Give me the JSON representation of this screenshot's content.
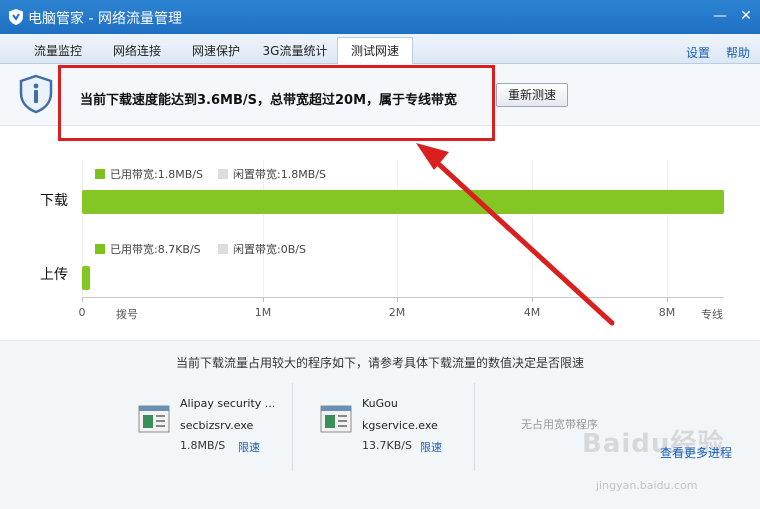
{
  "window": {
    "title": "电脑管家 - 网络流量管理",
    "minimize": "—",
    "close": "✕"
  },
  "tabs": [
    {
      "label": "流量监控",
      "active": false
    },
    {
      "label": "网络连接",
      "active": false
    },
    {
      "label": "网速保护",
      "active": false
    },
    {
      "label": "3G流量统计",
      "active": false
    },
    {
      "label": "测试网速",
      "active": true
    }
  ],
  "tab_links": {
    "settings": "设置",
    "help": "帮助"
  },
  "result": {
    "text": "当前下载速度能达到3.6MB/S，总带宽超过20M，属于专线带宽",
    "retest_label": "重新测速"
  },
  "download": {
    "label": "下载",
    "used_label": "已用带宽:1.8MB/S",
    "idle_label": "闲置带宽:1.8MB/S",
    "fill_fraction": 1.0
  },
  "upload": {
    "label": "上传",
    "used_label": "已用带宽:8.7KB/S",
    "idle_label": "闲置带宽:0B/S",
    "fill_fraction": 0.012
  },
  "axis_ticks": [
    "0",
    "拨号",
    "1M",
    "2M",
    "4M",
    "8M",
    "专线"
  ],
  "processes_note": "当前下载流量占用较大的程序如下，请参考具体下载流量的数值决定是否限速",
  "processes": [
    {
      "name": "Alipay security ...",
      "exe": "secbizsrv.exe",
      "speed": "1.8MB/S",
      "limit": "限速"
    },
    {
      "name": "KuGou",
      "exe": "kgservice.exe",
      "speed": "13.7KB/S",
      "limit": "限速"
    }
  ],
  "no_process": "无占用宽带程序",
  "more_link": "查看更多进程",
  "watermark": {
    "brand": "Baidu经验",
    "url": "jingyan.baidu.com"
  },
  "colors": {
    "titlebar": "#1f6fc2",
    "used": "#84c725",
    "idle": "#dddddd",
    "highlight": "#d9201e",
    "link": "#1a5fb4"
  }
}
